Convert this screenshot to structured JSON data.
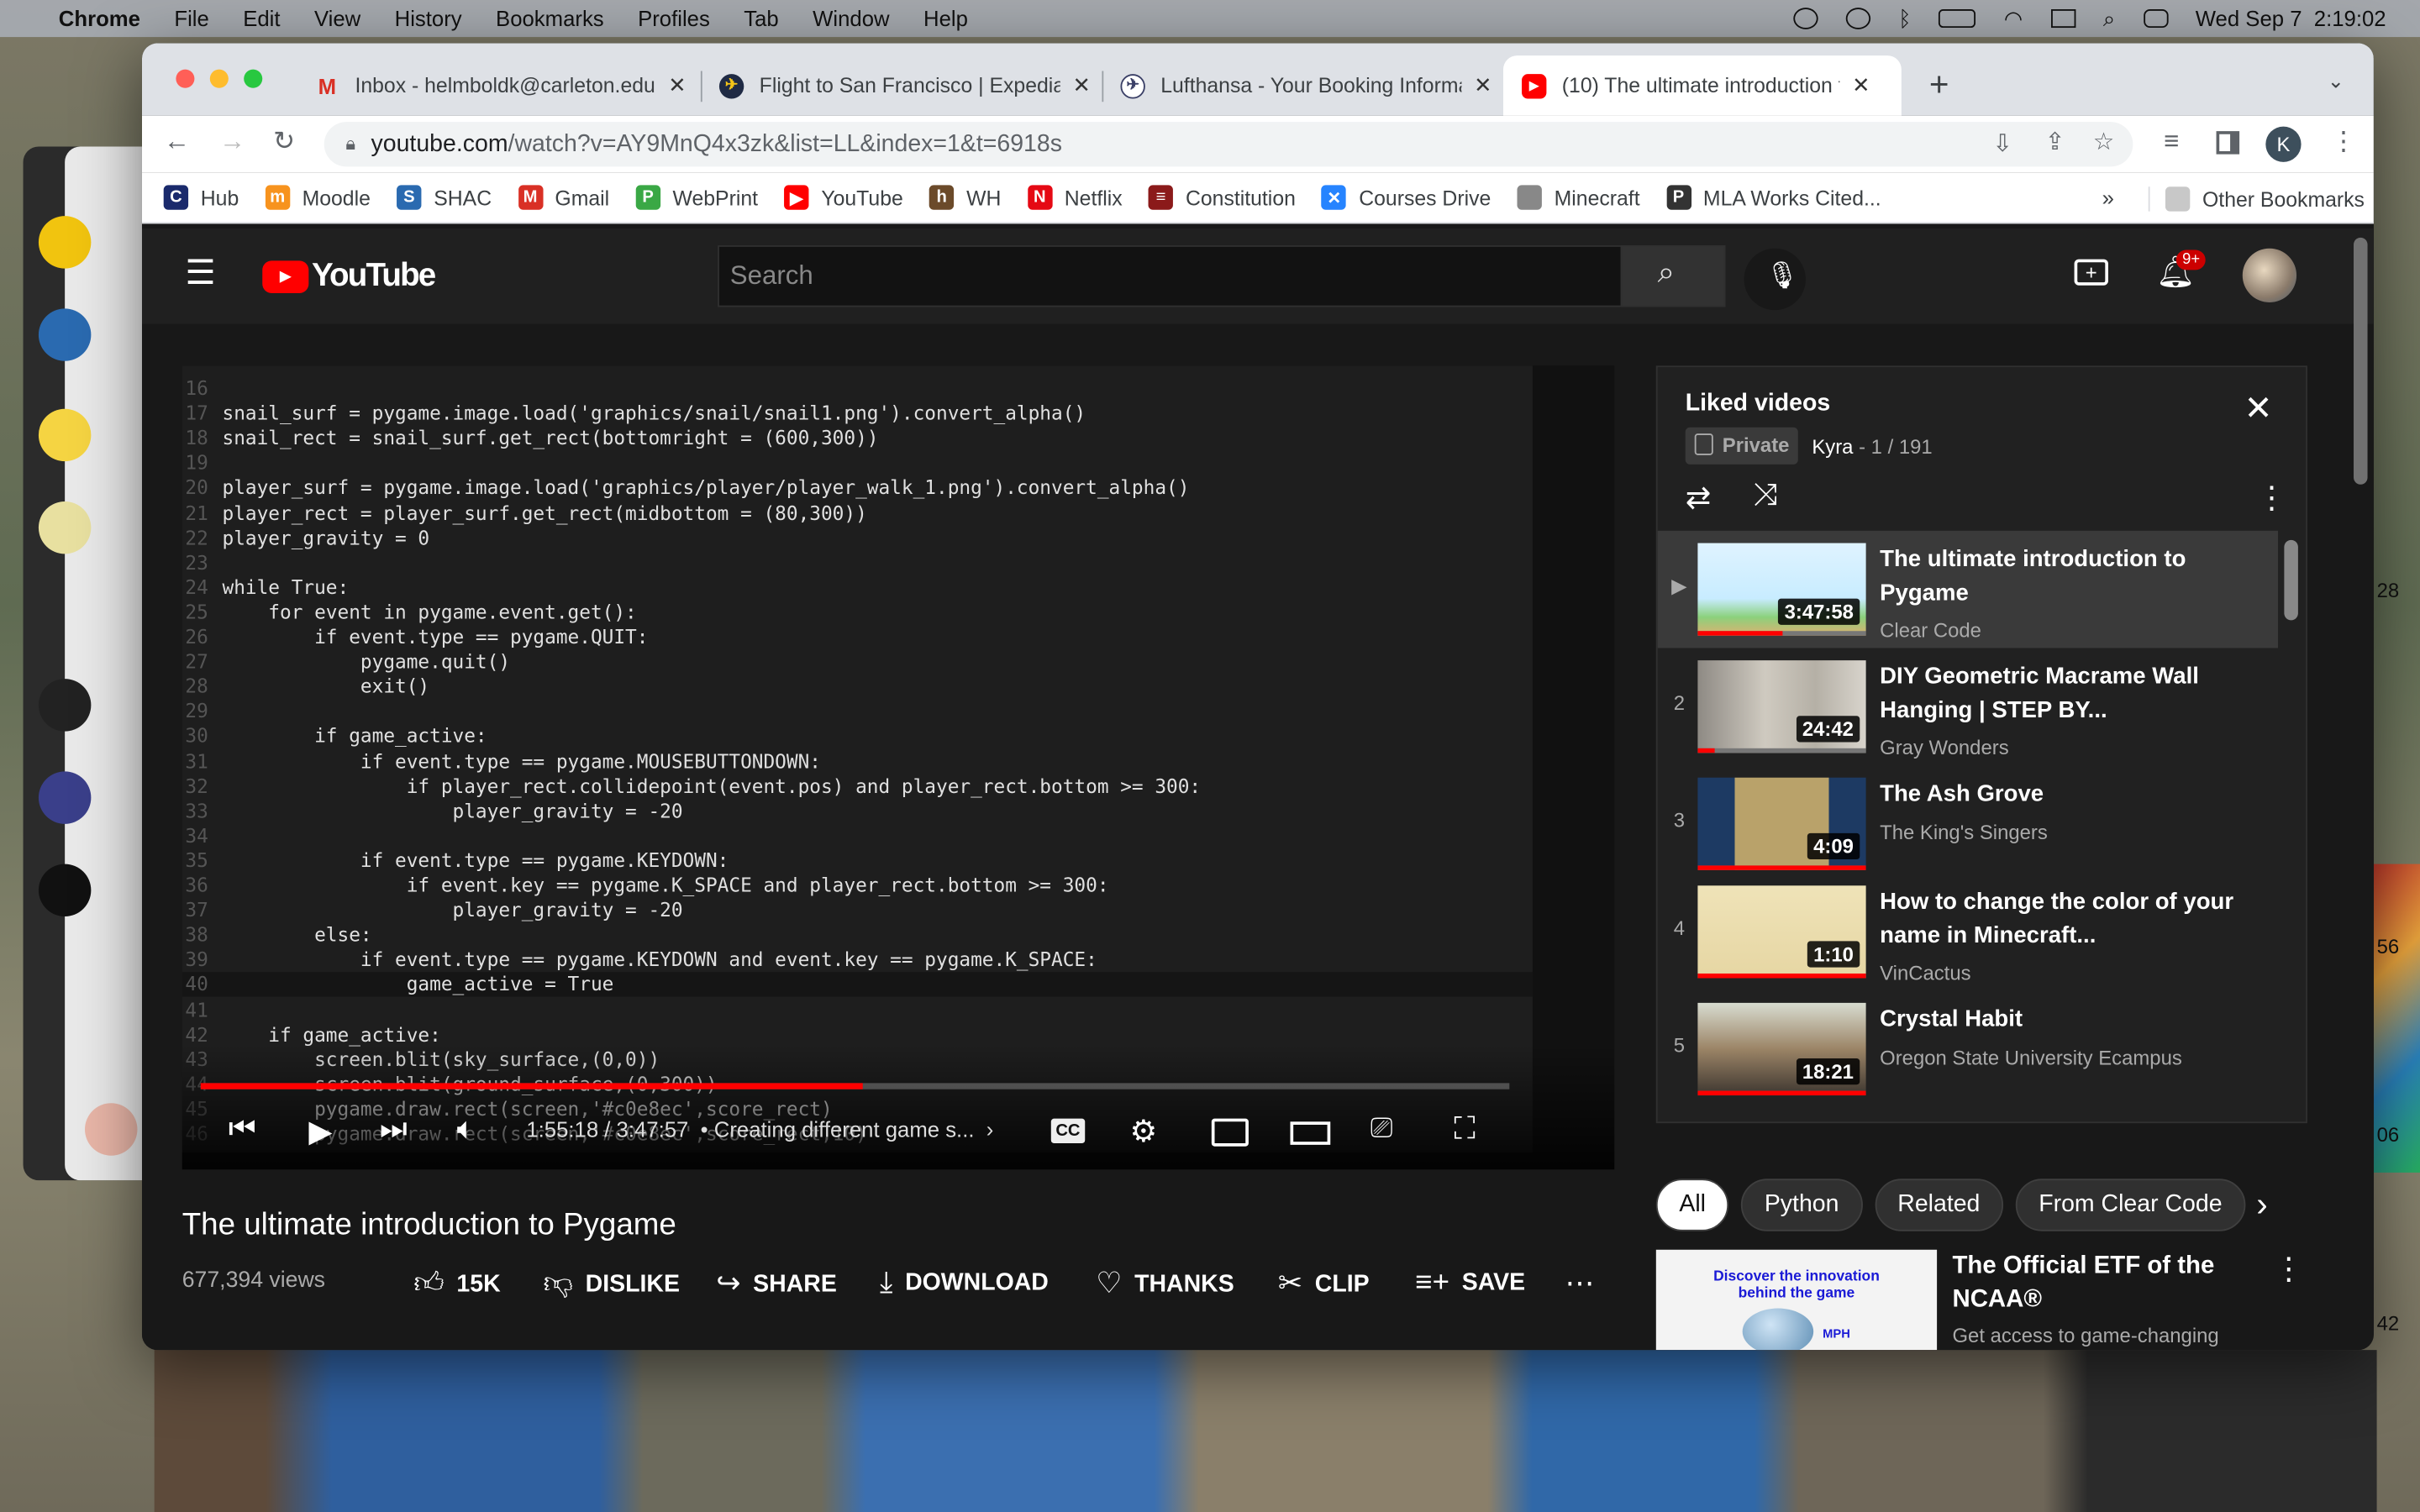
{
  "menubar": {
    "items": [
      "Chrome",
      "File",
      "Edit",
      "View",
      "History",
      "Bookmarks",
      "Profiles",
      "Tab",
      "Window",
      "Help"
    ],
    "clock": "Wed Sep 7  2:19:02"
  },
  "background_window": {
    "numbers": [
      "28",
      "56",
      "06",
      "42"
    ]
  },
  "tabs": [
    {
      "title": "Inbox - helmboldk@carleton.edu",
      "icon": "gmail-icon",
      "color": "#d93025"
    },
    {
      "title": "Flight to San Francisco | Expedia",
      "icon": "expedia-icon",
      "color": "#1f2a44"
    },
    {
      "title": "Lufthansa - Your Booking Information",
      "icon": "lufthansa-icon",
      "color": "#3a3f66"
    },
    {
      "title": "(10) The ultimate introduction to Pygame",
      "icon": "youtube-icon",
      "color": "#ff0000",
      "active": true
    }
  ],
  "toolbar": {
    "url_host": "youtube.com",
    "url_path": "/watch?v=AY9MnQ4x3zk&list=LL&index=1&t=6918s",
    "profile_initial": "K"
  },
  "bookmarks": [
    {
      "label": "Hub",
      "color": "#1a2a6c",
      "glyph": "C"
    },
    {
      "label": "Moodle",
      "color": "#f7931e",
      "glyph": "m"
    },
    {
      "label": "SHAC",
      "color": "#2a6ab0",
      "glyph": "S"
    },
    {
      "label": "Gmail",
      "color": "#d93025",
      "glyph": "M"
    },
    {
      "label": "WebPrint",
      "color": "#3aa845",
      "glyph": "P"
    },
    {
      "label": "YouTube",
      "color": "#ff0000",
      "glyph": "▶"
    },
    {
      "label": "WH",
      "color": "#6b4a2a",
      "glyph": "h"
    },
    {
      "label": "Netflix",
      "color": "#e50914",
      "glyph": "N"
    },
    {
      "label": "Constitution",
      "color": "#8b1a1a",
      "glyph": "≡"
    },
    {
      "label": "Courses Drive",
      "color": "#2684ff",
      "glyph": "✕"
    },
    {
      "label": "Minecraft",
      "color": "#888888",
      "glyph": ""
    },
    {
      "label": "MLA Works Cited...",
      "color": "#333333",
      "glyph": "P"
    }
  ],
  "bookmarks_overflow": "»",
  "other_bookmarks": "Other Bookmarks",
  "youtube": {
    "logo_text": "YouTube",
    "search_placeholder": "Search",
    "notifications_badge": "9+",
    "player": {
      "code_lines": [
        {
          "n": "16",
          "t": ""
        },
        {
          "n": "17",
          "t": "snail_surf = pygame.image.load('graphics/snail/snail1.png').convert_alpha()"
        },
        {
          "n": "18",
          "t": "snail_rect = snail_surf.get_rect(bottomright = (600,300))"
        },
        {
          "n": "19",
          "t": ""
        },
        {
          "n": "20",
          "t": "player_surf = pygame.image.load('graphics/player/player_walk_1.png').convert_alpha()"
        },
        {
          "n": "21",
          "t": "player_rect = player_surf.get_rect(midbottom = (80,300))"
        },
        {
          "n": "22",
          "t": "player_gravity = 0"
        },
        {
          "n": "23",
          "t": ""
        },
        {
          "n": "24",
          "t": "while True:"
        },
        {
          "n": "25",
          "t": "    for event in pygame.event.get():"
        },
        {
          "n": "26",
          "t": "        if event.type == pygame.QUIT:"
        },
        {
          "n": "27",
          "t": "            pygame.quit()"
        },
        {
          "n": "28",
          "t": "            exit()"
        },
        {
          "n": "29",
          "t": ""
        },
        {
          "n": "30",
          "t": "        if game_active:"
        },
        {
          "n": "31",
          "t": "            if event.type == pygame.MOUSEBUTTONDOWN:"
        },
        {
          "n": "32",
          "t": "                if player_rect.collidepoint(event.pos) and player_rect.bottom >= 300:"
        },
        {
          "n": "33",
          "t": "                    player_gravity = -20"
        },
        {
          "n": "34",
          "t": ""
        },
        {
          "n": "35",
          "t": "            if event.type == pygame.KEYDOWN:"
        },
        {
          "n": "36",
          "t": "                if event.key == pygame.K_SPACE and player_rect.bottom >= 300:"
        },
        {
          "n": "37",
          "t": "                    player_gravity = -20"
        },
        {
          "n": "38",
          "t": "        else:"
        },
        {
          "n": "39",
          "t": "            if event.type == pygame.KEYDOWN and event.key == pygame.K_SPACE:"
        },
        {
          "n": "40",
          "t": "                game_active = True"
        },
        {
          "n": "41",
          "t": ""
        },
        {
          "n": "42",
          "t": "    if game_active:"
        },
        {
          "n": "43",
          "t": "        screen.blit(sky_surface,(0,0))"
        },
        {
          "n": "44",
          "t": "        screen.blit(ground_surface,(0,300))"
        },
        {
          "n": "45",
          "t": "        pygame.draw.rect(screen,'#c0e8ec',score_rect)"
        },
        {
          "n": "46",
          "t": "        pygame.draw.rect(screen,'#c0e8ec',score_rect,10)"
        }
      ],
      "current_time": "1:55:18",
      "duration": "3:47:57",
      "time_display": "1:55:18 / 3:47:57",
      "chapter": "•  Creating different game s...",
      "progress_fraction": 0.506,
      "cc_label": "CC"
    },
    "video": {
      "title": "The ultimate introduction to Pygame",
      "views": "677,394 views",
      "actions": {
        "like": "15K",
        "dislike": "DISLIKE",
        "share": "SHARE",
        "download": "DOWNLOAD",
        "thanks": "THANKS",
        "clip": "CLIP",
        "save": "SAVE"
      }
    },
    "playlist": {
      "title": "Liked videos",
      "privacy": "Private",
      "owner": "Kyra",
      "position": "- 1 / 191",
      "items": [
        {
          "index": "▶",
          "title": "The ultimate introduction to Pygame",
          "channel": "Clear Code",
          "duration": "3:47:58",
          "watched": 0.5,
          "selected": true,
          "thumb": "linear-gradient(180deg,#dff3ff 0%,#c8ecff 60%,#8bd17c 80%,#e0b070 100%)"
        },
        {
          "index": "2",
          "title": "DIY Geometric Macrame Wall Hanging | STEP BY...",
          "channel": "Gray Wonders",
          "duration": "24:42",
          "watched": 0.1,
          "thumb": "linear-gradient(90deg,#8e8a84,#cfcac0 40%,#b5b0a6 70%,#d8d4cc)"
        },
        {
          "index": "3",
          "title": "The Ash Grove",
          "channel": "The King's Singers",
          "duration": "4:09",
          "watched": 1,
          "thumb": "linear-gradient(90deg,#1d3a63 0 22%,#b9a26a 22% 78%,#1d3a63 78%)"
        },
        {
          "index": "4",
          "title": "How to change the color of your name in Minecraft...",
          "channel": "VinCactus",
          "duration": "1:10",
          "watched": 1,
          "thumb": "linear-gradient(180deg,#efe3b8,#e6d6a3)"
        },
        {
          "index": "5",
          "title": "Crystal Habit",
          "channel": "Oregon State University Ecampus",
          "duration": "18:21",
          "watched": 1,
          "thumb": "linear-gradient(180deg,#d8dcd0 0%,#9b8466 50%,#3d3630 100%)"
        }
      ]
    },
    "chips": [
      {
        "label": "All",
        "active": true
      },
      {
        "label": "Python"
      },
      {
        "label": "Related"
      },
      {
        "label": "From Clear Code"
      }
    ],
    "ad": {
      "thumb_text": "Discover the innovation behind the game",
      "thumb_small": "MPH",
      "title": "The Official ETF of the NCAA®",
      "subtitle": "Get access to game-changing"
    }
  }
}
